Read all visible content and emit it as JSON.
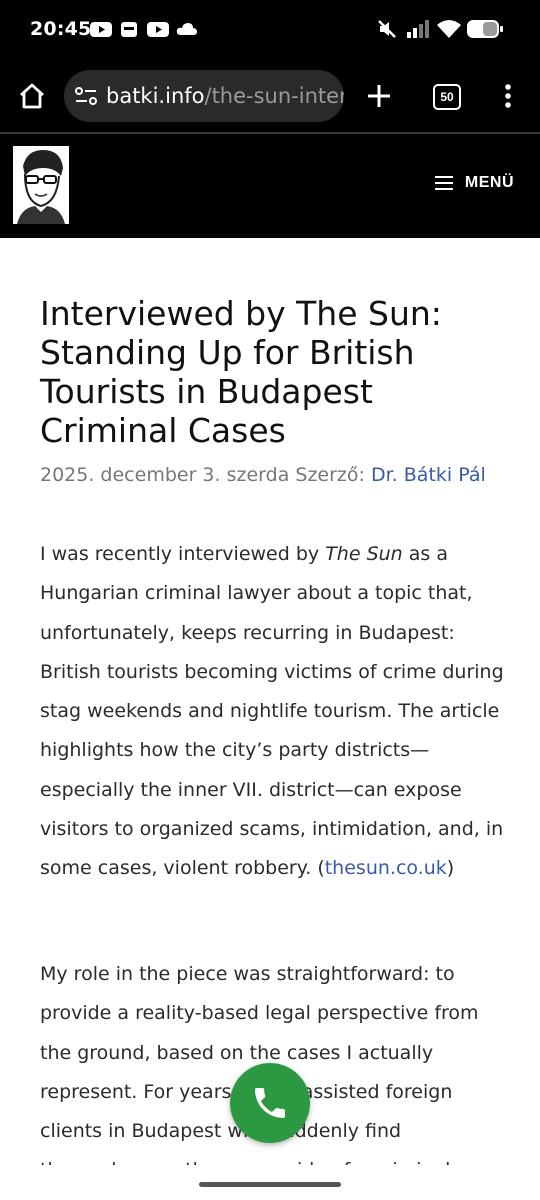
{
  "status_bar": {
    "time": "20:45",
    "left_icons": [
      "youtube-icon",
      "inbox-icon",
      "youtube-icon",
      "cloud-icon"
    ],
    "right_icons": [
      "mute-icon",
      "signal-icon",
      "wifi-icon",
      "battery-icon"
    ]
  },
  "browser": {
    "url_domain": "batki.info",
    "url_path": "/the-sun-interv",
    "tab_count": "50"
  },
  "site": {
    "menu_label": "MENÜ"
  },
  "article": {
    "title": "Interviewed by The Sun: Standing Up for British Tourists in Budapest Criminal Cases",
    "date": "2025. december 3. szerda",
    "author_prefix": "Szerző:",
    "author": "Dr. Bátki Pál",
    "p1_a": "I was recently interviewed by ",
    "p1_em": "The Sun",
    "p1_b": " as a Hungarian criminal lawyer about a topic that, unfortunately, keeps recurring in Budapest: British tourists becoming victims of crime during stag weekends and nightlife tourism. The article highlights how the city’s party districts—especially the inner VII. district—can expose visitors to organized scams, intimidation, and, in some cases, violent robbery. (",
    "p1_link": "thesun.co.uk",
    "p1_c": ")",
    "p2": "My role in the piece was straightforward: to provide a reality-based legal perspective from the ground, based on the cases I actually represent. For years I have assisted foreign clients in Budapest who suddenly find themselves on the wrong side of a criminal"
  }
}
